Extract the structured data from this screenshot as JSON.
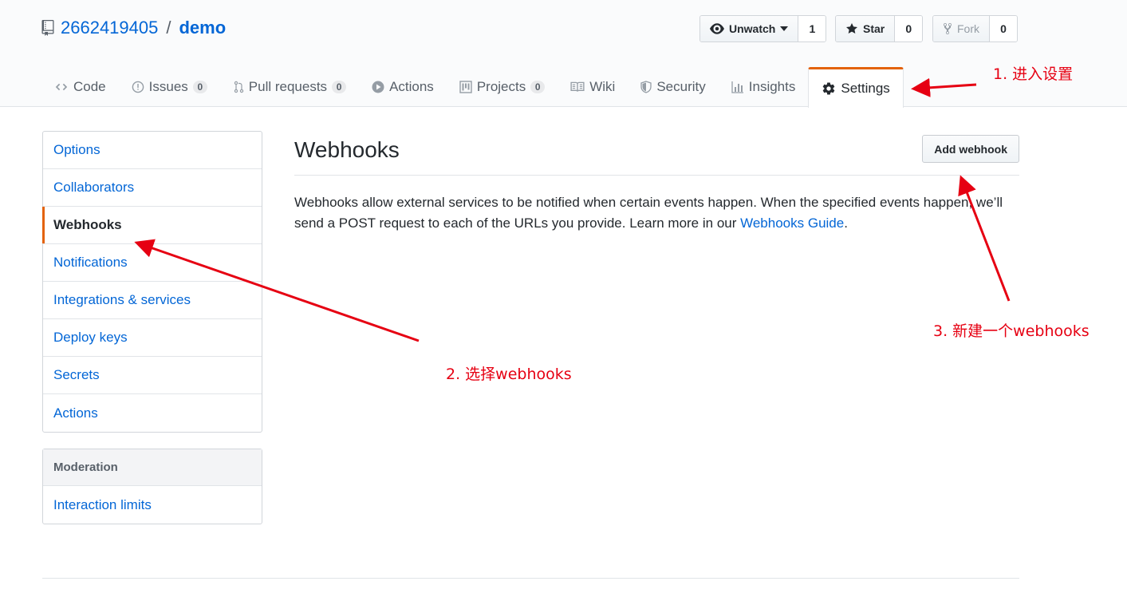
{
  "repo": {
    "owner": "2662419405",
    "separator": "/",
    "name": "demo"
  },
  "header_buttons": {
    "watch": {
      "label": "Unwatch",
      "count": "1"
    },
    "star": {
      "label": "Star",
      "count": "0"
    },
    "fork": {
      "label": "Fork",
      "count": "0"
    }
  },
  "tabs": [
    {
      "label": "Code"
    },
    {
      "label": "Issues",
      "count": "0"
    },
    {
      "label": "Pull requests",
      "count": "0"
    },
    {
      "label": "Actions"
    },
    {
      "label": "Projects",
      "count": "0"
    },
    {
      "label": "Wiki"
    },
    {
      "label": "Security"
    },
    {
      "label": "Insights"
    },
    {
      "label": "Settings"
    }
  ],
  "menu": {
    "items": [
      {
        "label": "Options"
      },
      {
        "label": "Collaborators"
      },
      {
        "label": "Webhooks"
      },
      {
        "label": "Notifications"
      },
      {
        "label": "Integrations & services"
      },
      {
        "label": "Deploy keys"
      },
      {
        "label": "Secrets"
      },
      {
        "label": "Actions"
      }
    ],
    "moderation_heading": "Moderation",
    "moderation_items": [
      {
        "label": "Interaction limits"
      }
    ]
  },
  "main": {
    "title": "Webhooks",
    "add_button": "Add webhook",
    "desc_text": "Webhooks allow external services to be notified when certain events happen. When the specified events happen, we’ll send a POST request to each of the URLs you provide. Learn more in our ",
    "desc_link": "Webhooks Guide",
    "desc_end": "."
  },
  "annotations": {
    "step1": "1. 进入设置",
    "step2": "2. 选择webhooks",
    "step3": "3. 新建一个webhooks"
  },
  "colors": {
    "link": "#0366d6",
    "selected_accent": "#e36209",
    "annotation": "#e60012"
  }
}
